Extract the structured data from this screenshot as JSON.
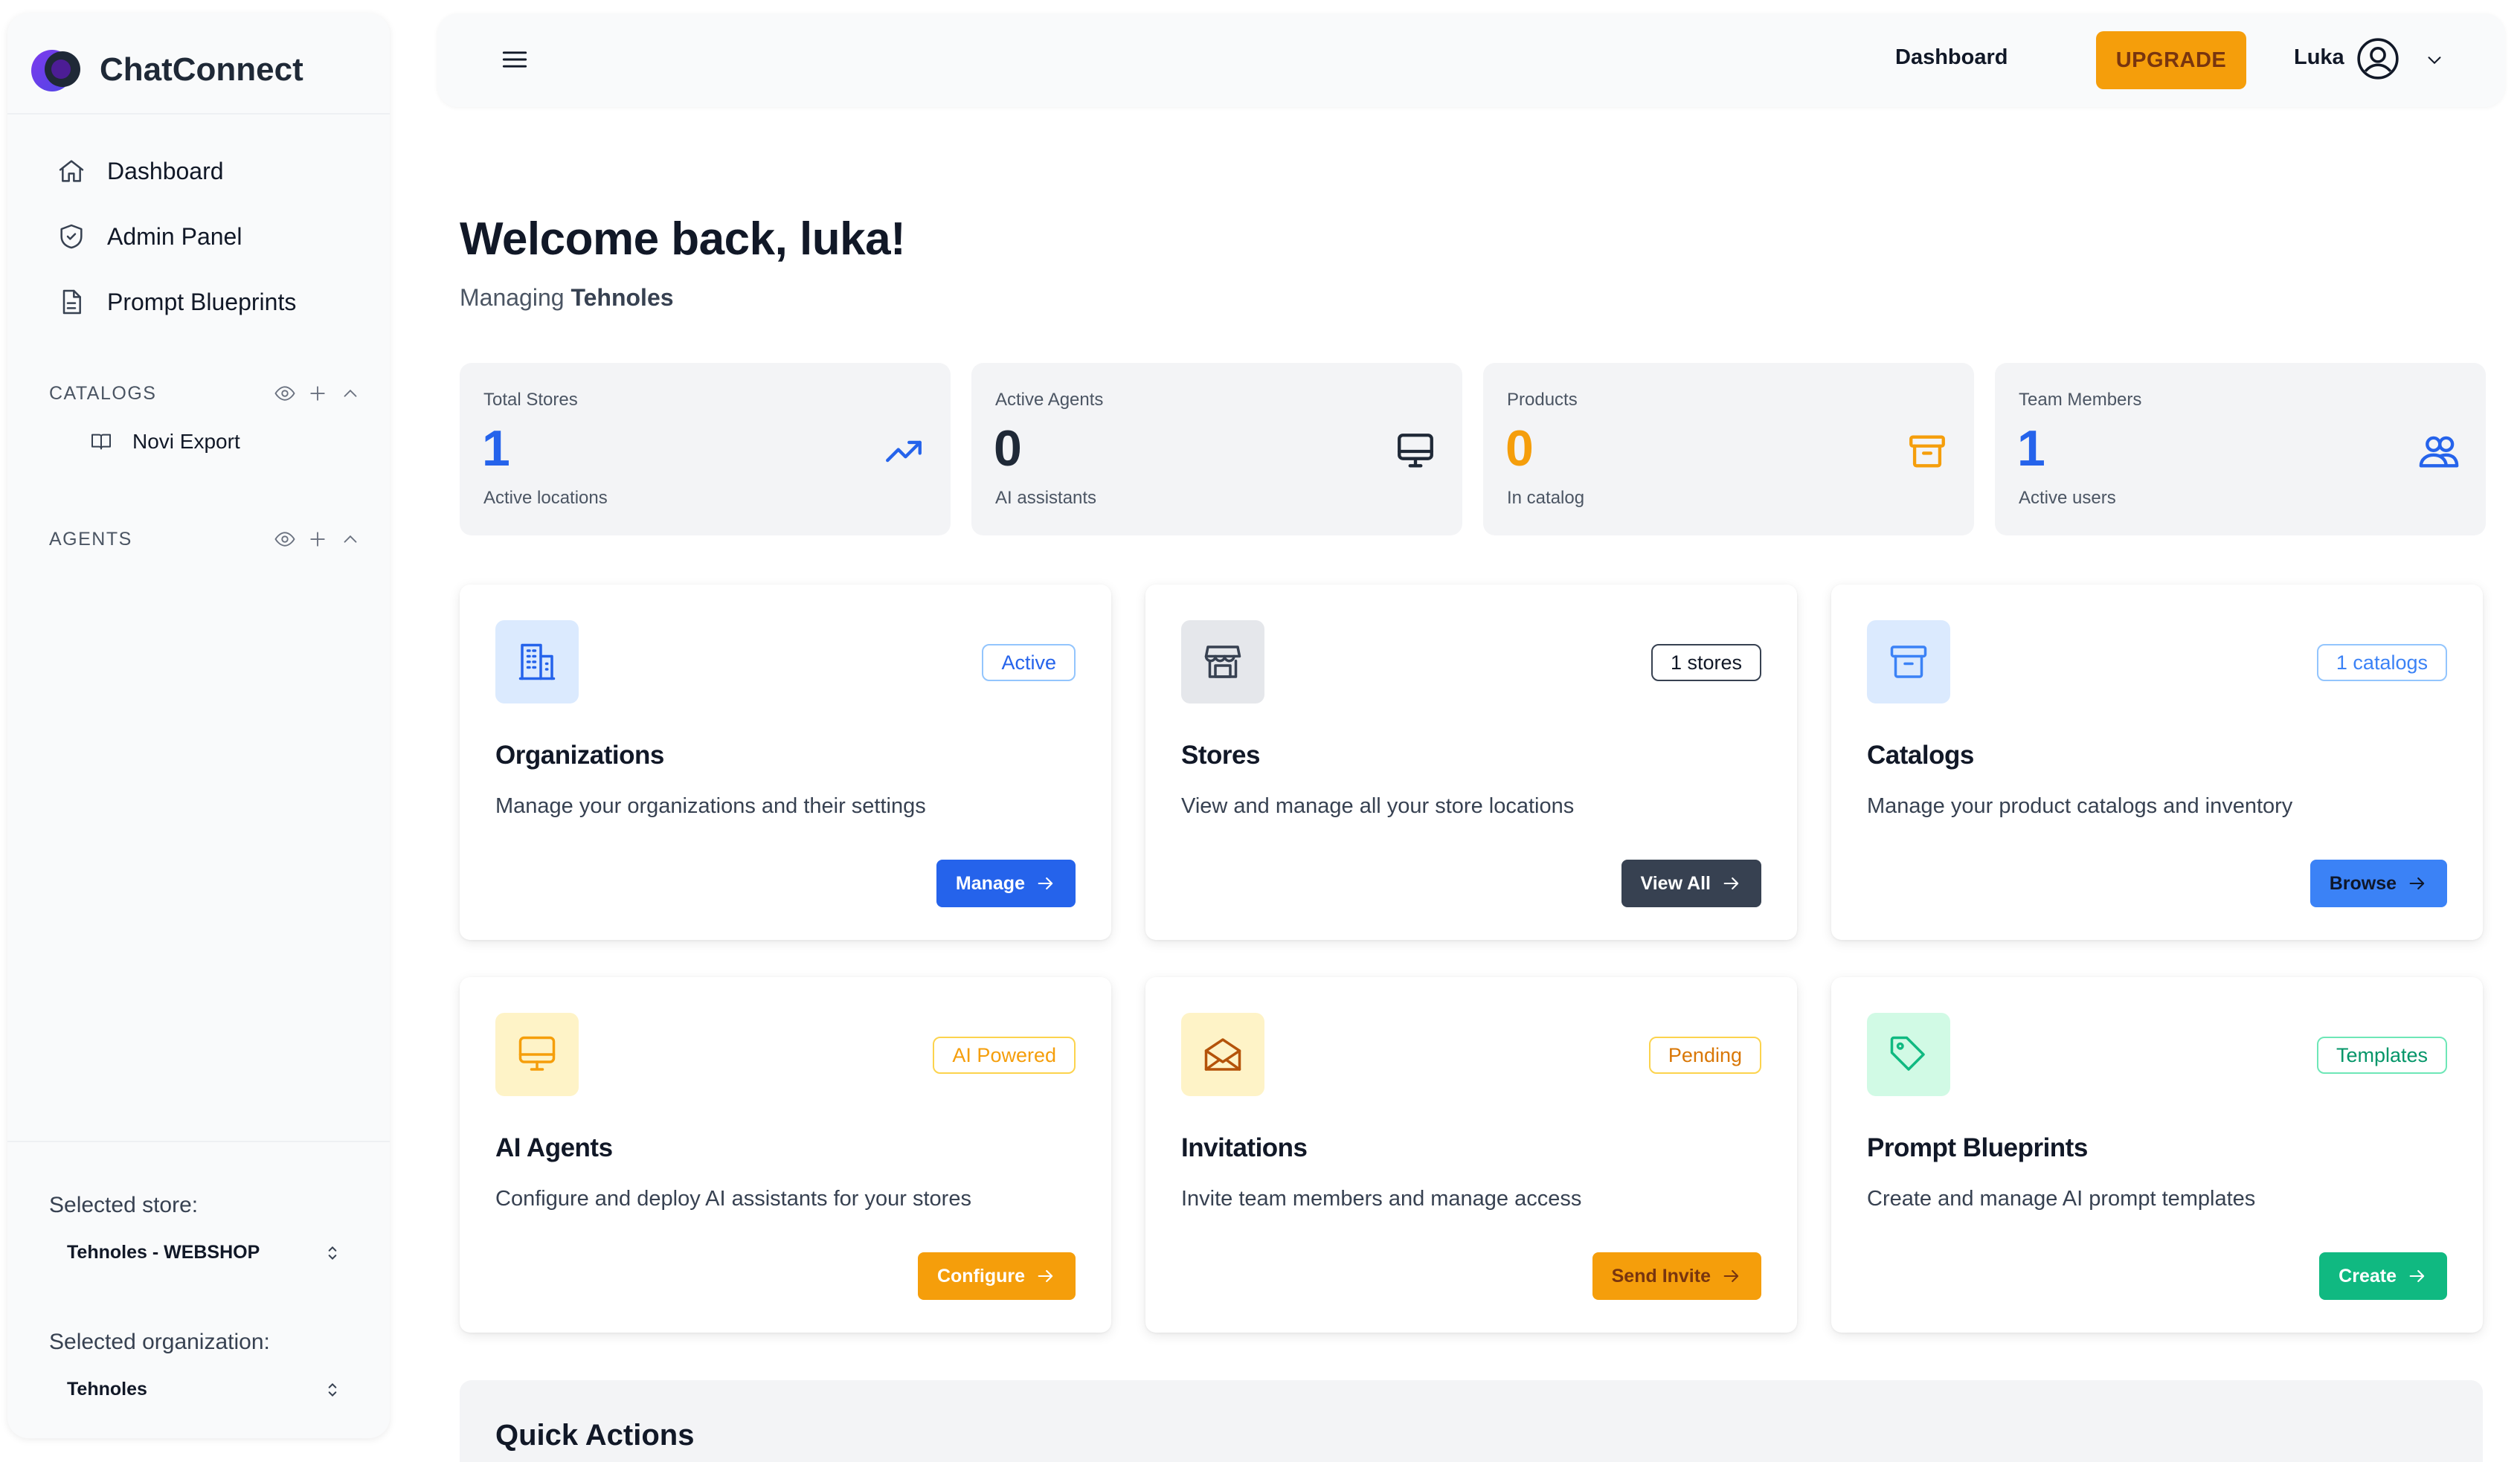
{
  "app": {
    "name": "ChatConnect"
  },
  "sidebar": {
    "nav": [
      {
        "label": "Dashboard",
        "icon": "home-icon"
      },
      {
        "label": "Admin Panel",
        "icon": "shield-icon"
      },
      {
        "label": "Prompt Blueprints",
        "icon": "document-icon"
      }
    ],
    "catalogs": {
      "title": "CATALOGS",
      "items": [
        {
          "label": "Novi Export",
          "icon": "book-icon"
        }
      ]
    },
    "agents": {
      "title": "AGENTS",
      "items": []
    },
    "selected_store": {
      "label": "Selected store:",
      "value": "Tehnoles - WEBSHOP"
    },
    "selected_org": {
      "label": "Selected organization:",
      "value": "Tehnoles"
    }
  },
  "topbar": {
    "dashboard_link": "Dashboard",
    "upgrade_label": "UPGRADE",
    "user_name": "Luka"
  },
  "main": {
    "welcome": "Welcome back, luka!",
    "managing_prefix": "Managing",
    "managing_org": "Tehnoles",
    "stats": [
      {
        "label": "Total Stores",
        "value": "1",
        "sub": "Active locations",
        "color": "#2563eb",
        "icon": "trending-up-icon"
      },
      {
        "label": "Active Agents",
        "value": "0",
        "sub": "AI assistants",
        "color": "#1f2937",
        "icon": "monitor-icon"
      },
      {
        "label": "Products",
        "value": "0",
        "sub": "In catalog",
        "color": "#f59e0b",
        "icon": "archive-icon"
      },
      {
        "label": "Team Members",
        "value": "1",
        "sub": "Active users",
        "color": "#2563eb",
        "icon": "users-icon"
      }
    ],
    "cards": [
      {
        "title": "Organizations",
        "desc": "Manage your organizations and their settings",
        "badge": "Active",
        "button": "Manage",
        "icon": "building-icon"
      },
      {
        "title": "Stores",
        "desc": "View and manage all your store locations",
        "badge": "1 stores",
        "button": "View All",
        "icon": "store-icon"
      },
      {
        "title": "Catalogs",
        "desc": "Manage your product catalogs and inventory",
        "badge": "1 catalogs",
        "button": "Browse",
        "icon": "archive-icon"
      },
      {
        "title": "AI Agents",
        "desc": "Configure and deploy AI assistants for your stores",
        "badge": "AI Powered",
        "button": "Configure",
        "icon": "monitor-icon"
      },
      {
        "title": "Invitations",
        "desc": "Invite team members and manage access",
        "badge": "Pending",
        "button": "Send Invite",
        "icon": "mail-open-icon"
      },
      {
        "title": "Prompt Blueprints",
        "desc": "Create and manage AI prompt templates",
        "badge": "Templates",
        "button": "Create",
        "icon": "tag-icon"
      }
    ],
    "quick_actions_title": "Quick Actions"
  },
  "colors": {
    "blue": "#2563eb",
    "light_blue": "#3b82f6",
    "slate": "#374151",
    "amber": "#f59e0b",
    "green": "#10b981"
  }
}
